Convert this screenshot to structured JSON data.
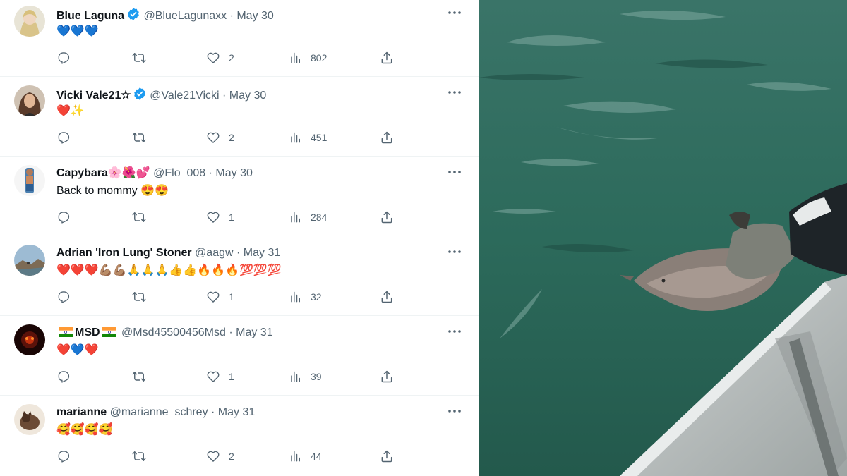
{
  "tweets": [
    {
      "name": "Blue Laguna",
      "verified": true,
      "handle": "@BlueLagunaxx",
      "date": "May 30",
      "body": "💙💙💙",
      "likes": "2",
      "views": "802",
      "avatar": "blonde-woman"
    },
    {
      "name": "Vicki Vale21✫",
      "verified": true,
      "handle": "@Vale21Vicki",
      "date": "May 30",
      "body": "❤️✨",
      "likes": "2",
      "views": "451",
      "avatar": "brunette-woman"
    },
    {
      "name": "Capybara🌸🌺💕",
      "verified": false,
      "handle": "@Flo_008",
      "date": "May 30",
      "body": "Back to mommy 😍😍",
      "likes": "1",
      "views": "284",
      "avatar": "standing-person"
    },
    {
      "name": "Adrian 'Iron Lung' Stoner",
      "verified": false,
      "handle": "@aagw",
      "date": "May 31",
      "body": "❤️❤️❤️💪🏽💪🏽🙏🙏🙏👍👍🔥🔥🔥💯💯💯",
      "likes": "1",
      "views": "32",
      "avatar": "landscape"
    },
    {
      "name": "MSD",
      "verified": false,
      "handle": "@Msd45500456Msd",
      "date": "May 31",
      "body": "❤️💙❤️",
      "likes": "1",
      "views": "39",
      "avatar": "dark-glow",
      "flags": true
    },
    {
      "name": "marianne",
      "verified": false,
      "handle": "@marianne_schrey",
      "date": "May 31",
      "body": "🥰🥰🥰🥰",
      "likes": "2",
      "views": "44",
      "avatar": "cat"
    }
  ],
  "separator": " · ",
  "icons": {
    "reply": "reply-icon",
    "retweet": "retweet-icon",
    "like": "heart-icon",
    "views": "views-icon",
    "share": "share-icon",
    "more": "more-icon",
    "verified": "verified-badge-icon"
  },
  "colors": {
    "verified": "#1d9bf0",
    "meta": "#536471",
    "text": "#0f1419",
    "water": "#2e6b5d"
  },
  "video": {
    "scene": "boat-releasing-baby-dolphin-into-water"
  }
}
